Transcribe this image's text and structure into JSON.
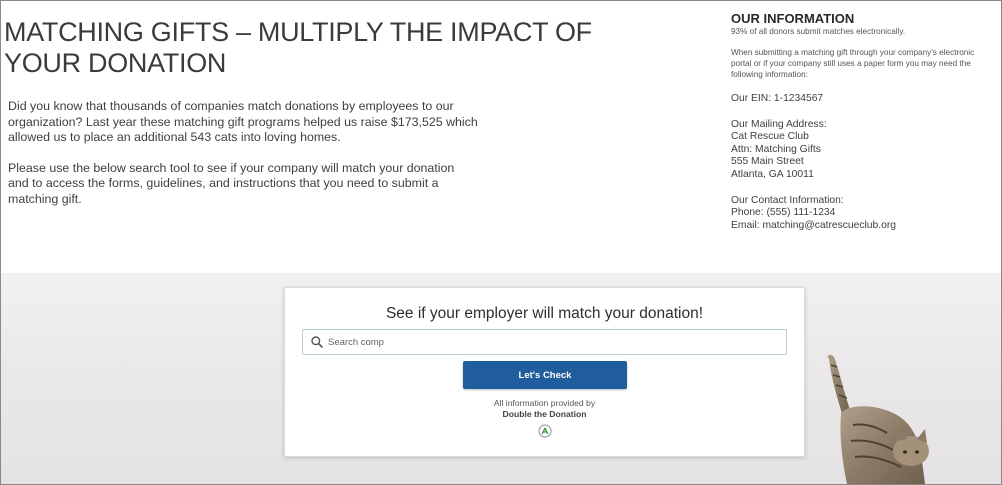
{
  "left": {
    "headline": "MATCHING GIFTS – MULTIPLY THE IMPACT OF YOUR DONATION",
    "paragraph1": "Did you know that thousands of companies match donations by employees to our organization? Last year these matching gift programs helped us raise $173,525 which allowed us to place an additional 543 cats into loving homes.",
    "paragraph2": "Please use the below search tool to see if your company will match your donation and to access the forms, guidelines, and instructions that you need to submit a matching gift."
  },
  "info": {
    "title": "OUR INFORMATION",
    "stat": "93% of all donors submit matches electronically.",
    "note": "When submitting a matching gift through your company's electronic portal or if your company still uses a paper form you may need the following information:",
    "ein": "Our EIN: 1-1234567",
    "mailing_label": "Our Mailing Address:",
    "mailing_lines": [
      "Cat Rescue Club",
      "Attn: Matching Gifts",
      "555 Main Street",
      "Atlanta, GA 10011"
    ],
    "contact_label": "Our Contact Information:",
    "phone": "Phone: (555) 111-1234",
    "email": "Email: matching@catrescueclub.org"
  },
  "widget": {
    "title": "See if your employer will match your donation!",
    "search_placeholder": "Search comp",
    "search_value": "",
    "button_label": "Let's Check",
    "provided_by": "All information provided by",
    "provider": "Double the Donation"
  },
  "colors": {
    "button": "#1f5d9c",
    "search_border": "#b9cfd3",
    "logo_green": "#3a9a3c"
  }
}
